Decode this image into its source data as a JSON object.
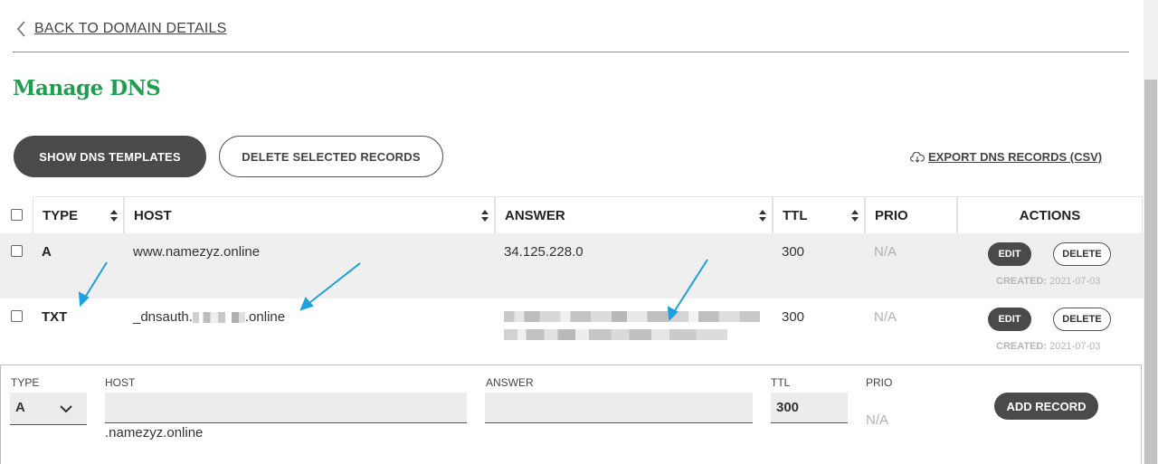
{
  "nav": {
    "back_label": "BACK TO DOMAIN DETAILS"
  },
  "page": {
    "title": "Manage DNS"
  },
  "toolbar": {
    "show_templates_label": "SHOW DNS TEMPLATES",
    "delete_selected_label": "DELETE SELECTED RECORDS",
    "export_label": "EXPORT DNS RECORDS (CSV)"
  },
  "table": {
    "headers": {
      "type": "TYPE",
      "host": "HOST",
      "answer": "ANSWER",
      "ttl": "TTL",
      "prio": "PRIO",
      "actions": "ACTIONS"
    },
    "rows": [
      {
        "type": "A",
        "host": "www.namezyz.online",
        "answer": "34.125.228.0",
        "ttl": "300",
        "prio": "N/A",
        "edit_label": "EDIT",
        "delete_label": "DELETE",
        "created_label": "CREATED:",
        "created_date": "2021-07-03"
      },
      {
        "type": "TXT",
        "host_prefix": "_dnsauth.",
        "host_suffix": ".online",
        "ttl": "300",
        "prio": "N/A",
        "edit_label": "EDIT",
        "delete_label": "DELETE",
        "created_label": "CREATED:",
        "created_date": "2021-07-03"
      }
    ]
  },
  "add_record": {
    "type_label": "TYPE",
    "type_value": "A",
    "host_label": "HOST",
    "host_value": "",
    "host_suffix": ".namezyz.online",
    "answer_label": "ANSWER",
    "answer_value": "",
    "ttl_label": "TTL",
    "ttl_value": "300",
    "prio_label": "PRIO",
    "prio_value": "N/A",
    "button_label": "ADD RECORD"
  },
  "colors": {
    "brand_green": "#1f9e50",
    "dark_button": "#4a4a4a",
    "annotation_arrow": "#1ea0dc",
    "row_highlight": "#efefef"
  },
  "icons": [
    "chevron-left-icon",
    "sort-icon",
    "cloud-download-icon",
    "chevron-down-icon",
    "checkbox-icon"
  ]
}
